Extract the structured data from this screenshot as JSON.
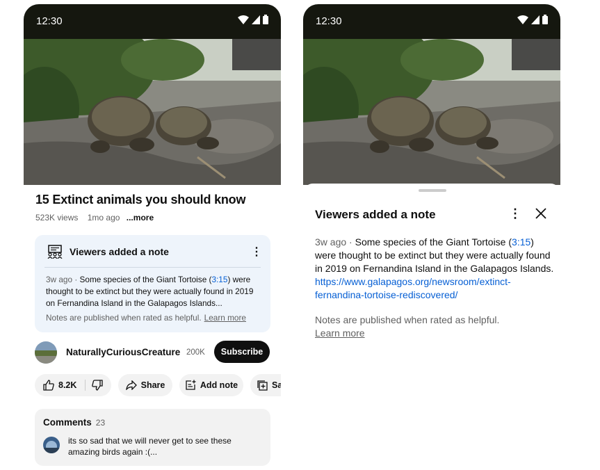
{
  "status_bar": {
    "time": "12:30"
  },
  "video": {
    "title": "15 Extinct animals you should know",
    "views": "523K views",
    "age": "1mo ago",
    "more_label": "...more"
  },
  "note_card": {
    "heading": "Viewers added a note",
    "age": "3w ago",
    "text_before_ts": "Some species of the Giant Tortoise (",
    "timestamp": "3:15",
    "text_after_ts": ") were thought to be extinct but they were actually found in 2019 on Fernandina Island in the Galapagos Islands...",
    "footer": "Notes are published when rated as helpful.",
    "learn_more": "Learn more"
  },
  "channel": {
    "name": "NaturallyCuriousCreature",
    "subscribers": "200K",
    "subscribe_label": "Subscribe"
  },
  "actions": {
    "likes": "8.2K",
    "share_label": "Share",
    "add_note_label": "Add note",
    "save_label": "Sa"
  },
  "comments": {
    "label": "Comments",
    "count": "23",
    "top_comment": "its so sad that we will never get to see these amazing birds again :(..."
  },
  "sheet": {
    "title": "Viewers added a note",
    "age": "3w ago",
    "text_before_ts": "Some species of the Giant Tortoise (",
    "timestamp": "3:15",
    "text_mid": ") were thought to be extinct but they were actually found in 2019 on Fernandina Island in the Galapagos Islands. ",
    "link": "https://www.galapagos.org/newsroom/extinct-fernandina-tortoise-rediscovered/",
    "footer": "Notes are published when rated as helpful.",
    "learn_more": "Learn more"
  },
  "colors": {
    "accent_link": "#065fd4",
    "note_card_bg": "#eef4fb",
    "status_bar_bg": "#15170f"
  },
  "icons": [
    "wifi-icon",
    "signal-icon",
    "battery-icon",
    "notes-icon",
    "more-vert-icon",
    "close-icon",
    "like-icon",
    "dislike-icon",
    "share-icon",
    "add-note-icon",
    "save-icon"
  ]
}
